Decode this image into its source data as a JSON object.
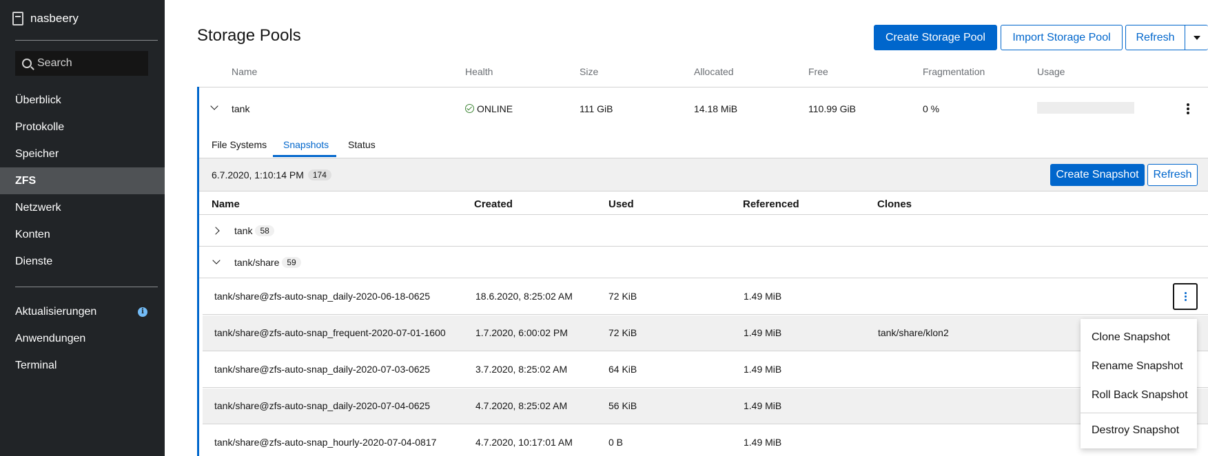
{
  "sidebar": {
    "host": "nasbeery",
    "search_placeholder": "Search",
    "items": [
      {
        "label": "Überblick"
      },
      {
        "label": "Protokolle"
      },
      {
        "label": "Speicher"
      },
      {
        "label": "ZFS"
      },
      {
        "label": "Netzwerk"
      },
      {
        "label": "Konten"
      },
      {
        "label": "Dienste"
      }
    ],
    "items2": [
      {
        "label": "Aktualisierungen"
      },
      {
        "label": "Anwendungen"
      },
      {
        "label": "Terminal"
      }
    ]
  },
  "page": {
    "title": "Storage Pools",
    "create_pool": "Create Storage Pool",
    "import_pool": "Import Storage Pool",
    "refresh": "Refresh"
  },
  "pool_table": {
    "headers": [
      "Name",
      "Health",
      "Size",
      "Allocated",
      "Free",
      "Fragmentation",
      "Usage"
    ],
    "row": {
      "name": "tank",
      "health": "ONLINE",
      "size": "111 GiB",
      "allocated": "14.18 MiB",
      "free": "110.99 GiB",
      "fragmentation": "0 %"
    }
  },
  "tabs": [
    "File Systems",
    "Snapshots",
    "Status"
  ],
  "snapshots": {
    "timestamp": "6.7.2020, 1:10:14 PM",
    "count": "174",
    "create": "Create Snapshot",
    "refresh": "Refresh",
    "headers": [
      "Name",
      "Created",
      "Used",
      "Referenced",
      "Clones"
    ],
    "groups": [
      {
        "name": "tank",
        "count": "58"
      },
      {
        "name": "tank/share",
        "count": "59"
      }
    ],
    "rows": [
      {
        "name": "tank/share@zfs-auto-snap_daily-2020-06-18-0625",
        "created": "18.6.2020, 8:25:02 AM",
        "used": "72 KiB",
        "referenced": "1.49 MiB",
        "clones": ""
      },
      {
        "name": "tank/share@zfs-auto-snap_frequent-2020-07-01-1600",
        "created": "1.7.2020, 6:00:02 PM",
        "used": "72 KiB",
        "referenced": "1.49 MiB",
        "clones": "tank/share/klon2"
      },
      {
        "name": "tank/share@zfs-auto-snap_daily-2020-07-03-0625",
        "created": "3.7.2020, 8:25:02 AM",
        "used": "64 KiB",
        "referenced": "1.49 MiB",
        "clones": ""
      },
      {
        "name": "tank/share@zfs-auto-snap_daily-2020-07-04-0625",
        "created": "4.7.2020, 8:25:02 AM",
        "used": "56 KiB",
        "referenced": "1.49 MiB",
        "clones": ""
      },
      {
        "name": "tank/share@zfs-auto-snap_hourly-2020-07-04-0817",
        "created": "4.7.2020, 10:17:01 AM",
        "used": "0 B",
        "referenced": "1.49 MiB",
        "clones": ""
      }
    ]
  },
  "menu": {
    "items": [
      "Clone Snapshot",
      "Rename Snapshot",
      "Roll Back Snapshot"
    ],
    "danger": "Destroy Snapshot"
  }
}
